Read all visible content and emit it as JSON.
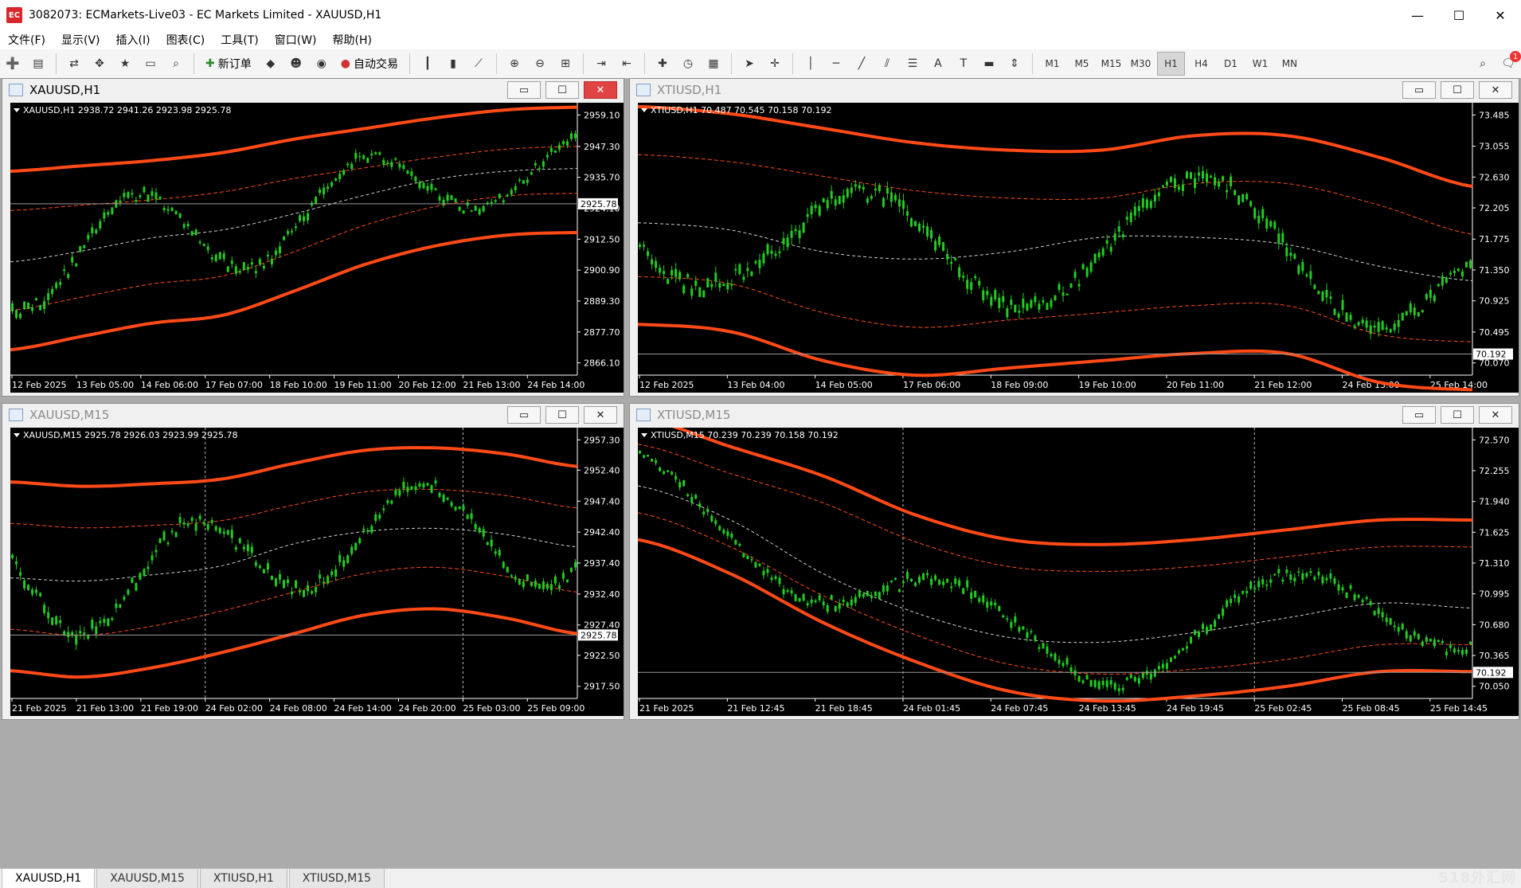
{
  "app": {
    "title": "3082073: ECMarkets-Live03 - EC Markets Limited - XAUUSD,H1",
    "icon_label": "EC",
    "minimize": "—",
    "maximize": "☐",
    "close": "✕"
  },
  "menu": [
    "文件(F)",
    "显示(V)",
    "插入(I)",
    "图表(C)",
    "工具(T)",
    "窗口(W)",
    "帮助(H)"
  ],
  "toolbar": {
    "new_order": "新订单",
    "auto_trading": "自动交易",
    "timeframes": [
      "M1",
      "M5",
      "M15",
      "M30",
      "H1",
      "H4",
      "D1",
      "W1",
      "MN"
    ],
    "active_timeframe": "H1",
    "notifications": "1"
  },
  "colors": {
    "bull": "#22cc22",
    "band_thick": "#ff4a17",
    "band_thin": "#ff4a17",
    "mid": "#d0d0d0",
    "chart_bg": "#000000",
    "axis_text": "#ffffff"
  },
  "charts": [
    {
      "title": "XAUUSD,H1",
      "state": "active",
      "info": "XAUUSD,H1  2938.72 2941.26 2923.98 2925.78",
      "y_ticks": [
        "2959.10",
        "2947.30",
        "2935.70",
        "2924.10",
        "2912.50",
        "2900.90",
        "2889.30",
        "2877.70",
        "2866.10"
      ],
      "y_range": [
        2866.1,
        2959.1
      ],
      "price_label": "2925.78",
      "price": 2925.78,
      "x_ticks": [
        "12 Feb 2025",
        "13 Feb 05:00",
        "14 Feb 06:00",
        "17 Feb 07:00",
        "18 Feb 10:00",
        "19 Feb 11:00",
        "20 Feb 12:00",
        "21 Feb 13:00",
        "24 Feb 14:00"
      ],
      "upper_band": [
        2938,
        2940,
        2942,
        2945,
        2950,
        2954,
        2958,
        2961,
        2962
      ],
      "lower_band": [
        2871,
        2876,
        2881,
        2884,
        2893,
        2903,
        2910,
        2914,
        2915
      ],
      "mid_line": [
        2904,
        2908,
        2913,
        2916,
        2922,
        2929,
        2935,
        2938,
        2939
      ],
      "vlines": []
    },
    {
      "title": "XTIUSD,H1",
      "state": "inactive",
      "info": "XTIUSD,H1  70.487 70.545 70.158 70.192",
      "y_ticks": [
        "73.485",
        "73.055",
        "72.630",
        "72.205",
        "71.775",
        "71.350",
        "70.925",
        "70.495",
        "70.070"
      ],
      "y_range": [
        70.07,
        73.485
      ],
      "price_label": "70.192",
      "price": 70.192,
      "x_ticks": [
        "12 Feb 2025",
        "13 Feb 04:00",
        "14 Feb 05:00",
        "17 Feb 06:00",
        "18 Feb 09:00",
        "19 Feb 10:00",
        "20 Feb 11:00",
        "21 Feb 12:00",
        "24 Feb 13:00",
        "25 Feb 14:00"
      ],
      "upper_band": [
        73.6,
        73.5,
        73.3,
        73.1,
        73.0,
        73.0,
        73.2,
        73.2,
        72.9,
        72.5
      ],
      "lower_band": [
        70.6,
        70.5,
        70.1,
        69.9,
        70.0,
        70.1,
        70.2,
        70.2,
        69.8,
        69.7
      ],
      "mid_line": [
        72.0,
        71.9,
        71.6,
        71.5,
        71.6,
        71.8,
        71.8,
        71.7,
        71.4,
        71.2
      ],
      "vlines": []
    },
    {
      "title": "XAUUSD,M15",
      "state": "inactive",
      "info": "XAUUSD,M15  2925.78 2926.03 2923.99 2925.78",
      "y_ticks": [
        "2957.30",
        "2952.40",
        "2947.40",
        "2942.40",
        "2937.40",
        "2932.40",
        "2927.40",
        "2922.50",
        "2917.50"
      ],
      "y_range": [
        2917.5,
        2957.3
      ],
      "price_label": "2925.78",
      "price": 2925.78,
      "x_ticks": [
        "21 Feb 2025",
        "21 Feb 13:00",
        "21 Feb 19:00",
        "24 Feb 02:00",
        "24 Feb 08:00",
        "24 Feb 14:00",
        "24 Feb 20:00",
        "25 Feb 03:00",
        "25 Feb 09:00"
      ],
      "upper_band": [
        2950.5,
        2949.8,
        2950.2,
        2951.0,
        2953.5,
        2955.6,
        2956.0,
        2955.0,
        2953.0
      ],
      "lower_band": [
        2920.0,
        2919.0,
        2920.5,
        2923.0,
        2926.0,
        2929.0,
        2930.0,
        2928.5,
        2926.0
      ],
      "mid_line": [
        2935.0,
        2934.5,
        2935.5,
        2937.0,
        2940.5,
        2942.5,
        2943.0,
        2942.0,
        2940.0
      ],
      "vlines": [
        3,
        7
      ]
    },
    {
      "title": "XTIUSD,M15",
      "state": "inactive",
      "info": "XTIUSD,M15  70.239 70.239 70.158 70.192",
      "y_ticks": [
        "72.570",
        "72.255",
        "71.940",
        "71.625",
        "71.310",
        "70.995",
        "70.680",
        "70.365",
        "70.050"
      ],
      "y_range": [
        70.05,
        72.57
      ],
      "price_label": "70.192",
      "price": 70.192,
      "x_ticks": [
        "21 Feb 2025",
        "21 Feb 12:45",
        "21 Feb 18:45",
        "24 Feb 01:45",
        "24 Feb 07:45",
        "24 Feb 13:45",
        "24 Feb 19:45",
        "25 Feb 02:45",
        "25 Feb 08:45",
        "25 Feb 14:45"
      ],
      "upper_band": [
        72.8,
        72.5,
        72.2,
        71.8,
        71.55,
        71.5,
        71.55,
        71.65,
        71.75,
        71.75
      ],
      "lower_band": [
        71.55,
        71.2,
        70.7,
        70.3,
        70.0,
        69.9,
        69.95,
        70.05,
        70.2,
        70.2
      ],
      "mid_line": [
        72.1,
        71.75,
        71.2,
        70.8,
        70.55,
        70.5,
        70.6,
        70.75,
        70.9,
        70.85
      ],
      "vlines": [
        3,
        7
      ]
    }
  ],
  "tabs": [
    "XAUUSD,H1",
    "XAUUSD,M15",
    "XTIUSD,H1",
    "XTIUSD,M15"
  ],
  "watermark": "518外汇网"
}
